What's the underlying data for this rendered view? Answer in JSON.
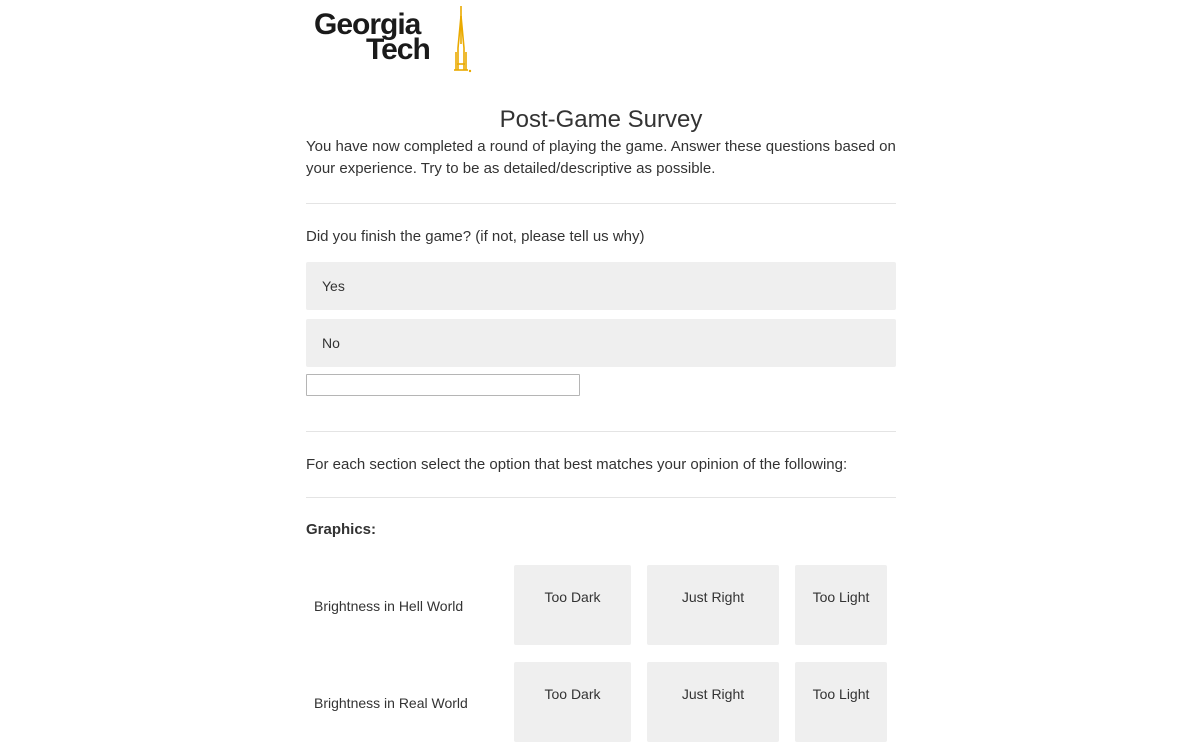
{
  "logo": {
    "line1": "Georgia",
    "line2": "Tech",
    "spire_color": "#eaaa00"
  },
  "survey": {
    "title": "Post-Game Survey",
    "intro": "You have now completed a round of playing the game. Answer these questions based on your experience. Try to be as detailed/descriptive as possible.",
    "q1": {
      "text": "Did you finish the game? (if not, please tell us why)",
      "options": [
        "Yes",
        "No"
      ],
      "text_entry_value": ""
    },
    "instructions": "For each section select the option that best matches your opinion of the following:",
    "graphics": {
      "header": "Graphics:",
      "scale": [
        "Too Dark",
        "Just Right",
        "Too Light"
      ],
      "rows": [
        {
          "label": "Brightness in Hell World"
        },
        {
          "label": "Brightness in Real World"
        }
      ]
    }
  },
  "colors": {
    "choice_bg": "#efefef",
    "text": "#333333",
    "divider": "#e4e4e4"
  }
}
